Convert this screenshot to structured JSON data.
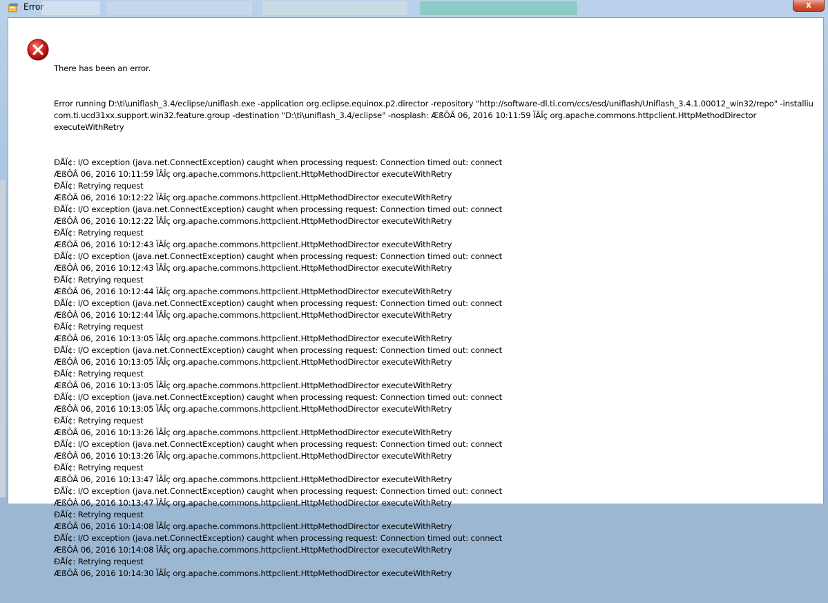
{
  "window": {
    "title": "Error",
    "close_label": "x"
  },
  "dialog": {
    "heading": "There has been an error.",
    "command": "Error running D:\\ti\\uniflash_3.4/eclipse/uniflash.exe -application org.eclipse.equinox.p2.director -repository \"http://software-dl.ti.com/ccs/esd/uniflash/Uniflash_3.4.1.00012_win32/repo\" -installiu com.ti.ucd31xx.support.win32.feature.group -destination \"D:\\ti\\uniflash_3.4/eclipse\" -nosplash: ÆßÔÂ 06, 2016 10:11:59 ÏÂÎç org.apache.commons.httpclient.HttpMethodDirector executeWithRetry",
    "log_lines": [
      "ÐÅÏ¢: I/O exception (java.net.ConnectException) caught when processing request: Connection timed out: connect",
      "ÆßÔÂ 06, 2016 10:11:59 ÏÂÎç org.apache.commons.httpclient.HttpMethodDirector executeWithRetry",
      "ÐÅÏ¢: Retrying request",
      "ÆßÔÂ 06, 2016 10:12:22 ÏÂÎç org.apache.commons.httpclient.HttpMethodDirector executeWithRetry",
      "ÐÅÏ¢: I/O exception (java.net.ConnectException) caught when processing request: Connection timed out: connect",
      "ÆßÔÂ 06, 2016 10:12:22 ÏÂÎç org.apache.commons.httpclient.HttpMethodDirector executeWithRetry",
      "ÐÅÏ¢: Retrying request",
      "ÆßÔÂ 06, 2016 10:12:43 ÏÂÎç org.apache.commons.httpclient.HttpMethodDirector executeWithRetry",
      "ÐÅÏ¢: I/O exception (java.net.ConnectException) caught when processing request: Connection timed out: connect",
      "ÆßÔÂ 06, 2016 10:12:43 ÏÂÎç org.apache.commons.httpclient.HttpMethodDirector executeWithRetry",
      "ÐÅÏ¢: Retrying request",
      "ÆßÔÂ 06, 2016 10:12:44 ÏÂÎç org.apache.commons.httpclient.HttpMethodDirector executeWithRetry",
      "ÐÅÏ¢: I/O exception (java.net.ConnectException) caught when processing request: Connection timed out: connect",
      "ÆßÔÂ 06, 2016 10:12:44 ÏÂÎç org.apache.commons.httpclient.HttpMethodDirector executeWithRetry",
      "ÐÅÏ¢: Retrying request",
      "ÆßÔÂ 06, 2016 10:13:05 ÏÂÎç org.apache.commons.httpclient.HttpMethodDirector executeWithRetry",
      "ÐÅÏ¢: I/O exception (java.net.ConnectException) caught when processing request: Connection timed out: connect",
      "ÆßÔÂ 06, 2016 10:13:05 ÏÂÎç org.apache.commons.httpclient.HttpMethodDirector executeWithRetry",
      "ÐÅÏ¢: Retrying request",
      "ÆßÔÂ 06, 2016 10:13:05 ÏÂÎç org.apache.commons.httpclient.HttpMethodDirector executeWithRetry",
      "ÐÅÏ¢: I/O exception (java.net.ConnectException) caught when processing request: Connection timed out: connect",
      "ÆßÔÂ 06, 2016 10:13:05 ÏÂÎç org.apache.commons.httpclient.HttpMethodDirector executeWithRetry",
      "ÐÅÏ¢: Retrying request",
      "ÆßÔÂ 06, 2016 10:13:26 ÏÂÎç org.apache.commons.httpclient.HttpMethodDirector executeWithRetry",
      "ÐÅÏ¢: I/O exception (java.net.ConnectException) caught when processing request: Connection timed out: connect",
      "ÆßÔÂ 06, 2016 10:13:26 ÏÂÎç org.apache.commons.httpclient.HttpMethodDirector executeWithRetry",
      "ÐÅÏ¢: Retrying request",
      "ÆßÔÂ 06, 2016 10:13:47 ÏÂÎç org.apache.commons.httpclient.HttpMethodDirector executeWithRetry",
      "ÐÅÏ¢: I/O exception (java.net.ConnectException) caught when processing request: Connection timed out: connect",
      "ÆßÔÂ 06, 2016 10:13:47 ÏÂÎç org.apache.commons.httpclient.HttpMethodDirector executeWithRetry",
      "ÐÅÏ¢: Retrying request",
      "ÆßÔÂ 06, 2016 10:14:08 ÏÂÎç org.apache.commons.httpclient.HttpMethodDirector executeWithRetry",
      "ÐÅÏ¢: I/O exception (java.net.ConnectException) caught when processing request: Connection timed out: connect",
      "ÆßÔÂ 06, 2016 10:14:08 ÏÂÎç org.apache.commons.httpclient.HttpMethodDirector executeWithRetry",
      "ÐÅÏ¢: Retrying request",
      "ÆßÔÂ 06, 2016 10:14:30 ÏÂÎç org.apache.commons.httpclient.HttpMethodDirector executeWithRetry"
    ]
  },
  "icons": {
    "app": "eclipse-app-icon",
    "error": "error-icon"
  },
  "colors": {
    "error_red": "#d01e1e",
    "close_red": "#c4401f"
  }
}
